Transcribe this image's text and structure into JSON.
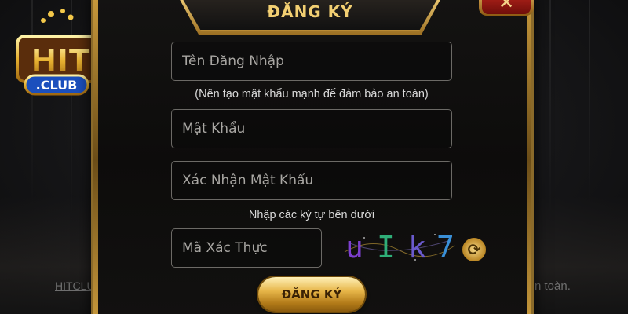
{
  "background": {
    "footer_left": "HITCLU",
    "footer_right": "n toàn."
  },
  "logo": {
    "brand_top": "HIT",
    "brand_bottom": ".CLUB"
  },
  "modal": {
    "title": "ĐĂNG KÝ",
    "close_label": "✕",
    "username": {
      "placeholder": "Tên Đăng Nhập",
      "value": ""
    },
    "password_hint": "(Nên tạo mật khẩu mạnh để đảm bảo an toàn)",
    "password": {
      "placeholder": "Mật Khẩu",
      "value": ""
    },
    "confirm_password": {
      "placeholder": "Xác Nhận Mật Khẩu",
      "value": ""
    },
    "captcha_hint": "Nhập các ký tự bên dưới",
    "captcha_input": {
      "placeholder": "Mã Xác Thực",
      "value": ""
    },
    "captcha_chars": [
      {
        "char": "u",
        "color": "#7d3fd0"
      },
      {
        "char": "I",
        "color": "#2fae78"
      },
      {
        "char": "k",
        "color": "#6a5acd"
      },
      {
        "char": "7",
        "color": "#3a8fd6"
      }
    ],
    "refresh_icon": "refresh-icon",
    "submit_label": "ĐĂNG KÝ"
  },
  "colors": {
    "gold": "#f2cf72",
    "modal_bg": "#0d0c0b",
    "close_red": "#b8241c"
  }
}
